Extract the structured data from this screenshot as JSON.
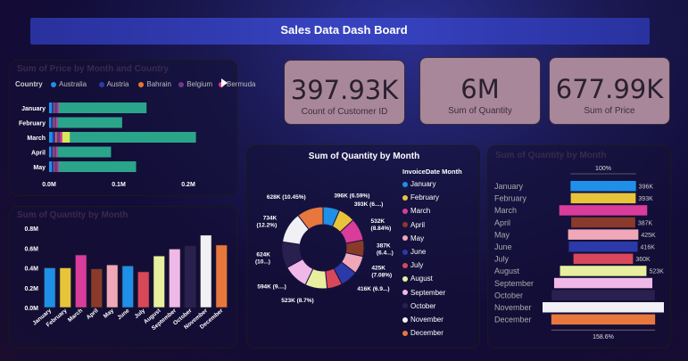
{
  "dashboard": {
    "title": "Sales Data Dash Board"
  },
  "kpis": [
    {
      "value": "397.93K",
      "label": "Count of Customer ID"
    },
    {
      "value": "6M",
      "label": "Sum of Quantity"
    },
    {
      "value": "677.99K",
      "label": "Sum of Price"
    }
  ],
  "panel_titles": {
    "bar_country": "Sum of Price by Month and Country",
    "column_month": "Sum of Quantity by Month",
    "donut": "Sum of Quantity by Month",
    "funnel": "Sum of Quantity by Month"
  },
  "country_legend": {
    "title": "Country",
    "items": [
      {
        "name": "Australia",
        "color": "#1f8fe8"
      },
      {
        "name": "Austria",
        "color": "#2b3aa8"
      },
      {
        "name": "Bahrain",
        "color": "#e8772e"
      },
      {
        "name": "Belgium",
        "color": "#6b3a8a"
      },
      {
        "name": "Bermuda",
        "color": "#d93c9a"
      }
    ],
    "more_icon": "play-arrow-icon"
  },
  "chart_data": [
    {
      "type": "bar",
      "orientation": "horizontal",
      "stacked": true,
      "categories": [
        "January",
        "February",
        "March",
        "April",
        "May"
      ],
      "series": [
        {
          "name": "Australia",
          "color": "#1f8fe8",
          "values": [
            0.004,
            0.003,
            0.005,
            0.003,
            0.004
          ]
        },
        {
          "name": "Austria",
          "color": "#2b3aa8",
          "values": [
            0.003,
            0.003,
            0.004,
            0.003,
            0.003
          ]
        },
        {
          "name": "Bahrain",
          "color": "#e8772e",
          "values": [
            0.001,
            0.001,
            0.002,
            0.001,
            0.001
          ]
        },
        {
          "name": "Belgium",
          "color": "#6b3a8a",
          "values": [
            0.004,
            0.003,
            0.005,
            0.003,
            0.004
          ]
        },
        {
          "name": "Bermuda",
          "color": "#d93c9a",
          "values": [
            0.002,
            0.002,
            0.003,
            0.002,
            0.002
          ]
        },
        {
          "color": "#d8e85a",
          "values": [
            0.0,
            0.0,
            0.011,
            0.0,
            0.0
          ]
        },
        {
          "color": "#2aa58a",
          "values": [
            0.126,
            0.093,
            0.181,
            0.077,
            0.111
          ]
        }
      ],
      "x_ticks": [
        "0.0M",
        "0.1M",
        "0.2M"
      ],
      "xlim": [
        0,
        0.2
      ]
    },
    {
      "type": "bar",
      "categories": [
        "January",
        "February",
        "March",
        "April",
        "May",
        "June",
        "July",
        "August",
        "September",
        "October",
        "November",
        "December"
      ],
      "values": [
        0.4,
        0.4,
        0.53,
        0.39,
        0.43,
        0.42,
        0.36,
        0.52,
        0.59,
        0.62,
        0.73,
        0.63
      ],
      "colors": [
        "#1f8fe8",
        "#e8c43a",
        "#d93c9a",
        "#8a3a2a",
        "#f0a8b8",
        "#1f8fe8",
        "#d9485a",
        "#e8f0a0",
        "#f0b8e8",
        "#2a2050",
        "#f0f0f5",
        "#e8773e"
      ],
      "y_ticks": [
        "0.0M",
        "0.2M",
        "0.4M",
        "0.6M",
        "0.8M"
      ],
      "ylim": [
        0,
        0.8
      ]
    },
    {
      "type": "pie",
      "legend_title": "InvoiceDate Month",
      "categories": [
        "January",
        "February",
        "March",
        "April",
        "May",
        "June",
        "July",
        "August",
        "September",
        "October",
        "November",
        "December"
      ],
      "values": [
        396,
        393,
        532,
        387,
        425,
        416,
        360,
        523,
        594,
        624,
        734,
        628
      ],
      "colors": [
        "#1f8fe8",
        "#e8c43a",
        "#d93c9a",
        "#8a3a2a",
        "#f0a8b8",
        "#2b3aa8",
        "#d9485a",
        "#e8f0a0",
        "#f0b8e8",
        "#2a2050",
        "#f0f0f5",
        "#e8773e"
      ],
      "labels": [
        "396K (6.59%)",
        "393K (6....)",
        "532K (8.84%)",
        "387K (6.4...)",
        "425K (7.08%)",
        "416K (6.9...)",
        "",
        "523K (8.7%)",
        "594K (9....)",
        "624K (10...)",
        "734K (12.2%)",
        "628K (10.45%)"
      ]
    },
    {
      "type": "bar",
      "orientation": "funnel",
      "categories": [
        "January",
        "February",
        "March",
        "April",
        "May",
        "June",
        "July",
        "August",
        "September",
        "October",
        "November",
        "December"
      ],
      "values": [
        396,
        393,
        532,
        387,
        425,
        416,
        360,
        523,
        594,
        624,
        734,
        628
      ],
      "colors": [
        "#1f8fe8",
        "#e8c43a",
        "#d93c9a",
        "#8a3a2a",
        "#f0a8b8",
        "#2b3aa8",
        "#d9485a",
        "#e8f0a0",
        "#f0b8e8",
        "#2a2050",
        "#f0f0f5",
        "#e8773e"
      ],
      "value_labels": [
        "396K",
        "393K",
        "",
        "387K",
        "425K",
        "416K",
        "360K",
        "523K",
        "",
        "",
        "",
        ""
      ],
      "top_label": "100%",
      "bottom_label": "158.6%"
    }
  ]
}
